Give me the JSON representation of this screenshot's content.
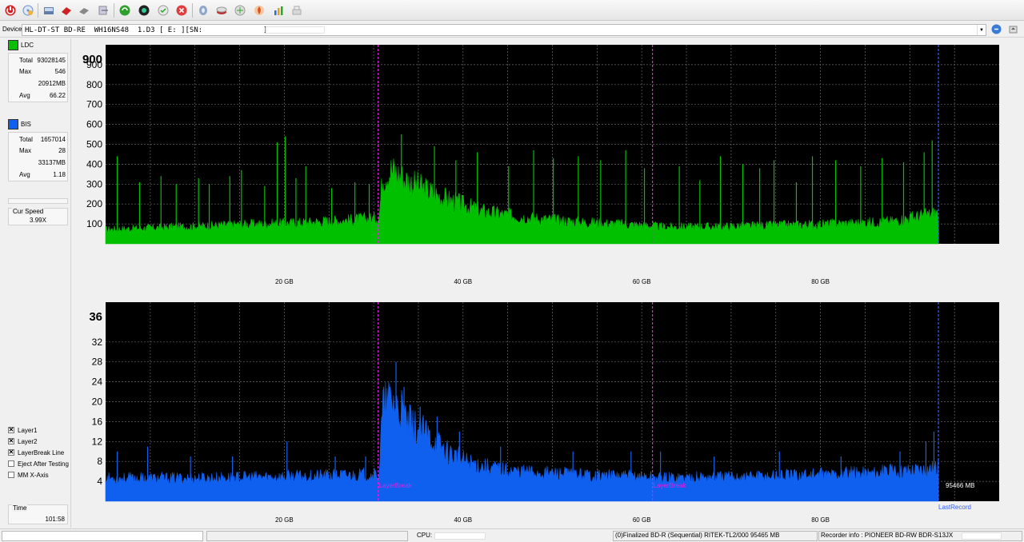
{
  "device": {
    "label": "Device:",
    "value": "HL-DT-ST BD-RE  WH16NS48  1.D3 [ E: ][SN:              ]"
  },
  "toolbar_icons": [
    "power-icon",
    "refresh-disc-icon",
    "drive-info-icon",
    "erase-disc-icon",
    "burn-disc-icon",
    "copy-disc-icon",
    "recycle-icon",
    "globe-icon",
    "settings-icon",
    "stop-icon",
    "disc-scan-icon",
    "disc-write-icon",
    "disc-burn-icon",
    "burn-fire-icon",
    "chart-icon",
    "clean-icon"
  ],
  "ldc": {
    "label": "LDC",
    "color": "#00c000",
    "stats": [
      {
        "key": "Total",
        "value": "93028145"
      },
      {
        "key": "Max",
        "value": "546"
      },
      {
        "key": "",
        "value": "20912MB"
      },
      {
        "key": "Avg",
        "value": "66.22"
      }
    ]
  },
  "bis": {
    "label": "BIS",
    "color": "#1060f0",
    "stats": [
      {
        "key": "Total",
        "value": "1657014"
      },
      {
        "key": "Max",
        "value": "28"
      },
      {
        "key": "",
        "value": "33137MB"
      },
      {
        "key": "Avg",
        "value": "1.18"
      }
    ]
  },
  "cur_speed": {
    "label": "Cur Speed",
    "value": "3.99X"
  },
  "options": [
    {
      "label": "Layer1",
      "checked": true
    },
    {
      "label": "Layer2",
      "checked": true
    },
    {
      "label": "LayerBreak Line",
      "checked": true
    },
    {
      "label": "Eject After Testing",
      "checked": false
    },
    {
      "label": "MM X-Axis",
      "checked": false
    }
  ],
  "time": {
    "label": "Time",
    "value": "101:58"
  },
  "chart_data": [
    {
      "type": "area",
      "series": [
        {
          "name": "LDC",
          "color": "#00c000"
        }
      ],
      "x_unit": "GB",
      "x_range": [
        0,
        100
      ],
      "ylim": [
        0,
        1000
      ],
      "y_ticks": [
        100,
        200,
        300,
        400,
        500,
        600,
        700,
        800,
        900
      ],
      "y_top_label": "900",
      "x_ticks": [
        {
          "value": 20,
          "label": "20 GB"
        },
        {
          "value": 40,
          "label": "40 GB"
        },
        {
          "value": 60,
          "label": "60 GB"
        },
        {
          "value": 80,
          "label": "80 GB"
        }
      ],
      "layer_breaks": [
        30.5,
        61.2
      ],
      "last_record": 93.2,
      "baseline_profile": [
        [
          0,
          70
        ],
        [
          5,
          78
        ],
        [
          10,
          85
        ],
        [
          15,
          95
        ],
        [
          20,
          100
        ],
        [
          25,
          110
        ],
        [
          30,
          125
        ],
        [
          30.6,
          130
        ],
        [
          31,
          330
        ],
        [
          32,
          360
        ],
        [
          34,
          300
        ],
        [
          36,
          260
        ],
        [
          38,
          220
        ],
        [
          40,
          190
        ],
        [
          42,
          160
        ],
        [
          45,
          140
        ],
        [
          48,
          125
        ],
        [
          52,
          110
        ],
        [
          56,
          100
        ],
        [
          61,
          90
        ],
        [
          62,
          82
        ],
        [
          70,
          85
        ],
        [
          80,
          95
        ],
        [
          88,
          110
        ],
        [
          93,
          150
        ]
      ],
      "spikes": [
        [
          1.3,
          440
        ],
        [
          3.8,
          310
        ],
        [
          6.2,
          340
        ],
        [
          7.9,
          300
        ],
        [
          10.4,
          330
        ],
        [
          11.6,
          300
        ],
        [
          13.9,
          340
        ],
        [
          15.2,
          370
        ],
        [
          17.8,
          290
        ],
        [
          19.2,
          510
        ],
        [
          20.1,
          540
        ],
        [
          21.3,
          330
        ],
        [
          22.4,
          390
        ],
        [
          25.3,
          280
        ],
        [
          27.9,
          310
        ],
        [
          29.5,
          300
        ],
        [
          33.1,
          550
        ],
        [
          36.8,
          490
        ],
        [
          39.2,
          420
        ],
        [
          41.6,
          460
        ],
        [
          45.1,
          390
        ],
        [
          47.9,
          470
        ],
        [
          50.1,
          430
        ],
        [
          52.9,
          440
        ],
        [
          55.4,
          420
        ],
        [
          58.2,
          470
        ],
        [
          60.3,
          380
        ],
        [
          64.2,
          390
        ],
        [
          66.5,
          320
        ],
        [
          68.8,
          440
        ],
        [
          71.3,
          400
        ],
        [
          73.2,
          380
        ],
        [
          74.8,
          420
        ],
        [
          77.3,
          310
        ],
        [
          79.1,
          440
        ],
        [
          81.7,
          420
        ],
        [
          84.5,
          390
        ],
        [
          86.9,
          430
        ],
        [
          89.3,
          410
        ],
        [
          91.6,
          460
        ],
        [
          92.5,
          520
        ]
      ]
    },
    {
      "type": "area",
      "series": [
        {
          "name": "BIS",
          "color": "#1060f0"
        }
      ],
      "x_unit": "GB",
      "x_range": [
        0,
        100
      ],
      "ylim": [
        0,
        40
      ],
      "y_ticks": [
        4,
        8,
        12,
        16,
        20,
        24,
        28,
        32
      ],
      "y_top_label": "36",
      "x_ticks": [
        {
          "value": 20,
          "label": "20 GB"
        },
        {
          "value": 40,
          "label": "40 GB"
        },
        {
          "value": 60,
          "label": "60 GB"
        },
        {
          "value": 80,
          "label": "80 GB"
        }
      ],
      "layer_breaks": [
        30.5,
        61.2
      ],
      "layer_break_label": "LayerBreak",
      "last_record": 93.2,
      "last_record_label": "LastRecord",
      "end_label": "95466 MB",
      "baseline_profile": [
        [
          0,
          4.5
        ],
        [
          10,
          4.5
        ],
        [
          20,
          4.8
        ],
        [
          30,
          5.2
        ],
        [
          30.6,
          5.5
        ],
        [
          31,
          18
        ],
        [
          32,
          20
        ],
        [
          34,
          15
        ],
        [
          36,
          13
        ],
        [
          38,
          10
        ],
        [
          40,
          8
        ],
        [
          42,
          7
        ],
        [
          45,
          6
        ],
        [
          50,
          5.5
        ],
        [
          56,
          5
        ],
        [
          61,
          4.8
        ],
        [
          62,
          4.6
        ],
        [
          70,
          4.8
        ],
        [
          80,
          5.2
        ],
        [
          88,
          5.8
        ],
        [
          93,
          6.6
        ]
      ],
      "spikes": [
        [
          1.3,
          10
        ],
        [
          4.7,
          11
        ],
        [
          9.5,
          9
        ],
        [
          14.2,
          9
        ],
        [
          20.3,
          12
        ],
        [
          25.7,
          9
        ],
        [
          29.1,
          9
        ],
        [
          32.5,
          28
        ],
        [
          33.4,
          23
        ],
        [
          35.2,
          19
        ],
        [
          37.1,
          17
        ],
        [
          39.6,
          14
        ],
        [
          44.2,
          11
        ],
        [
          52.3,
          10
        ],
        [
          58.8,
          10
        ],
        [
          62.1,
          10
        ],
        [
          68.1,
          9
        ],
        [
          75.4,
          10
        ],
        [
          82.3,
          9
        ],
        [
          88.9,
          10
        ],
        [
          91.8,
          12
        ],
        [
          92.7,
          14
        ]
      ]
    }
  ],
  "status": {
    "cpu_label": "CPU:",
    "disc_info": "(0)Finalized  BD-R (Sequential)  RITEK-TL2/000  95465 MB",
    "recorder_info": "Recorder info : PIONEER      BD-RW  BDR-S13JX"
  }
}
